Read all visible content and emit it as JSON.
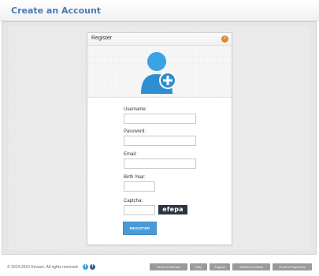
{
  "header": {
    "title": "Create an Account"
  },
  "card": {
    "title": "Register",
    "status_icon": "check-circle-icon",
    "avatar_icon": "add-user-icon"
  },
  "form": {
    "username_label": "Username:",
    "password_label": "Password:",
    "email_label": "Email:",
    "birth_year_label": "Birth Year:",
    "captcha_label": "Captcha:",
    "captcha_text": "efepa",
    "submit_label": "REGISTER"
  },
  "footer": {
    "copyright": "© 2014-2015 Kevace. All rights reserved.",
    "social": [
      "twitter-icon",
      "facebook-icon"
    ],
    "links": [
      "Terms of Service",
      "FAQ",
      "Support",
      "Referral Contest",
      "Proof of Payments"
    ]
  },
  "colors": {
    "accent": "#4a78b9",
    "button": "#4a9ad8",
    "status": "#e2862f",
    "captcha_bg": "#2c3341"
  }
}
